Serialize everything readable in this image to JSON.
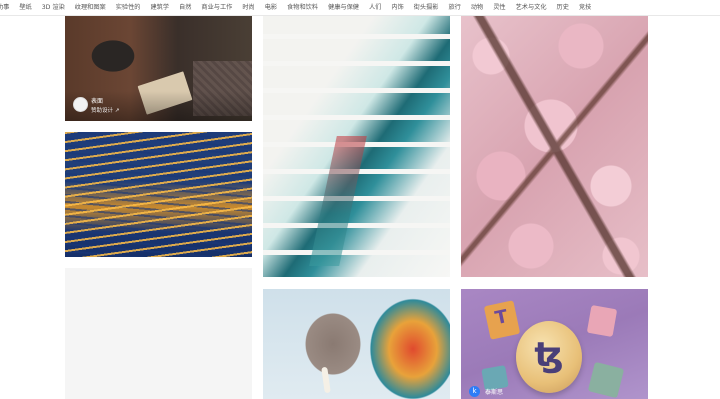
{
  "nav": {
    "items": [
      "功事",
      "壁纸",
      "3D 渲染",
      "纹理和图案",
      "实验性的",
      "建筑学",
      "自然",
      "商业与工作",
      "时尚",
      "电影",
      "食物和饮料",
      "健康与保健",
      "人们",
      "内饰",
      "街头摄影",
      "旅行",
      "动物",
      "灵性",
      "艺术与文化",
      "历史",
      "竞技"
    ]
  },
  "tiles": {
    "couch": {
      "author_name": "表面",
      "author_sub": "赞助设计 ↗"
    },
    "tezos": {
      "author_badge": "k",
      "author_name": "泰斯思"
    }
  }
}
